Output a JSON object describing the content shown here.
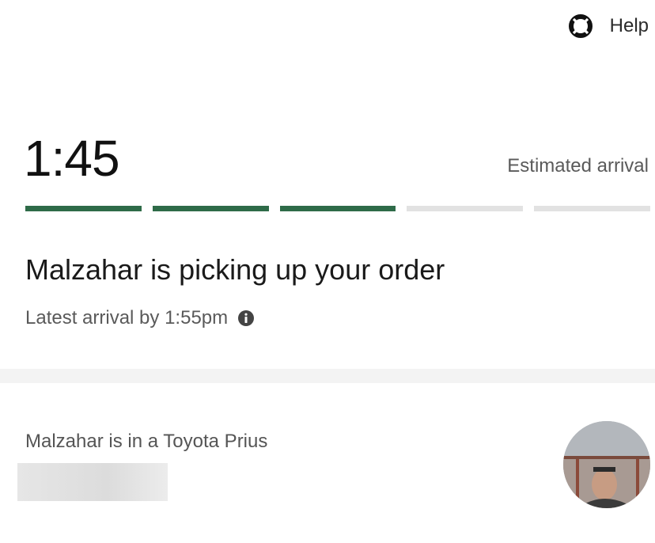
{
  "header": {
    "help_label": "Help",
    "help_icon": "lifebuoy-icon"
  },
  "eta": {
    "time": "1:45",
    "label": "Estimated arrival"
  },
  "progress": {
    "total_steps": 5,
    "completed_steps": 3,
    "accent_color": "#2e6b48",
    "inactive_color": "#e2e2e2"
  },
  "status": {
    "title": "Malzahar is picking up your order",
    "latest_arrival": "Latest arrival by 1:55pm",
    "info_icon": "info-icon"
  },
  "driver": {
    "vehicle_text": "Malzahar is in a Toyota Prius",
    "license_plate": "redacted",
    "avatar_icon": "driver-avatar"
  }
}
